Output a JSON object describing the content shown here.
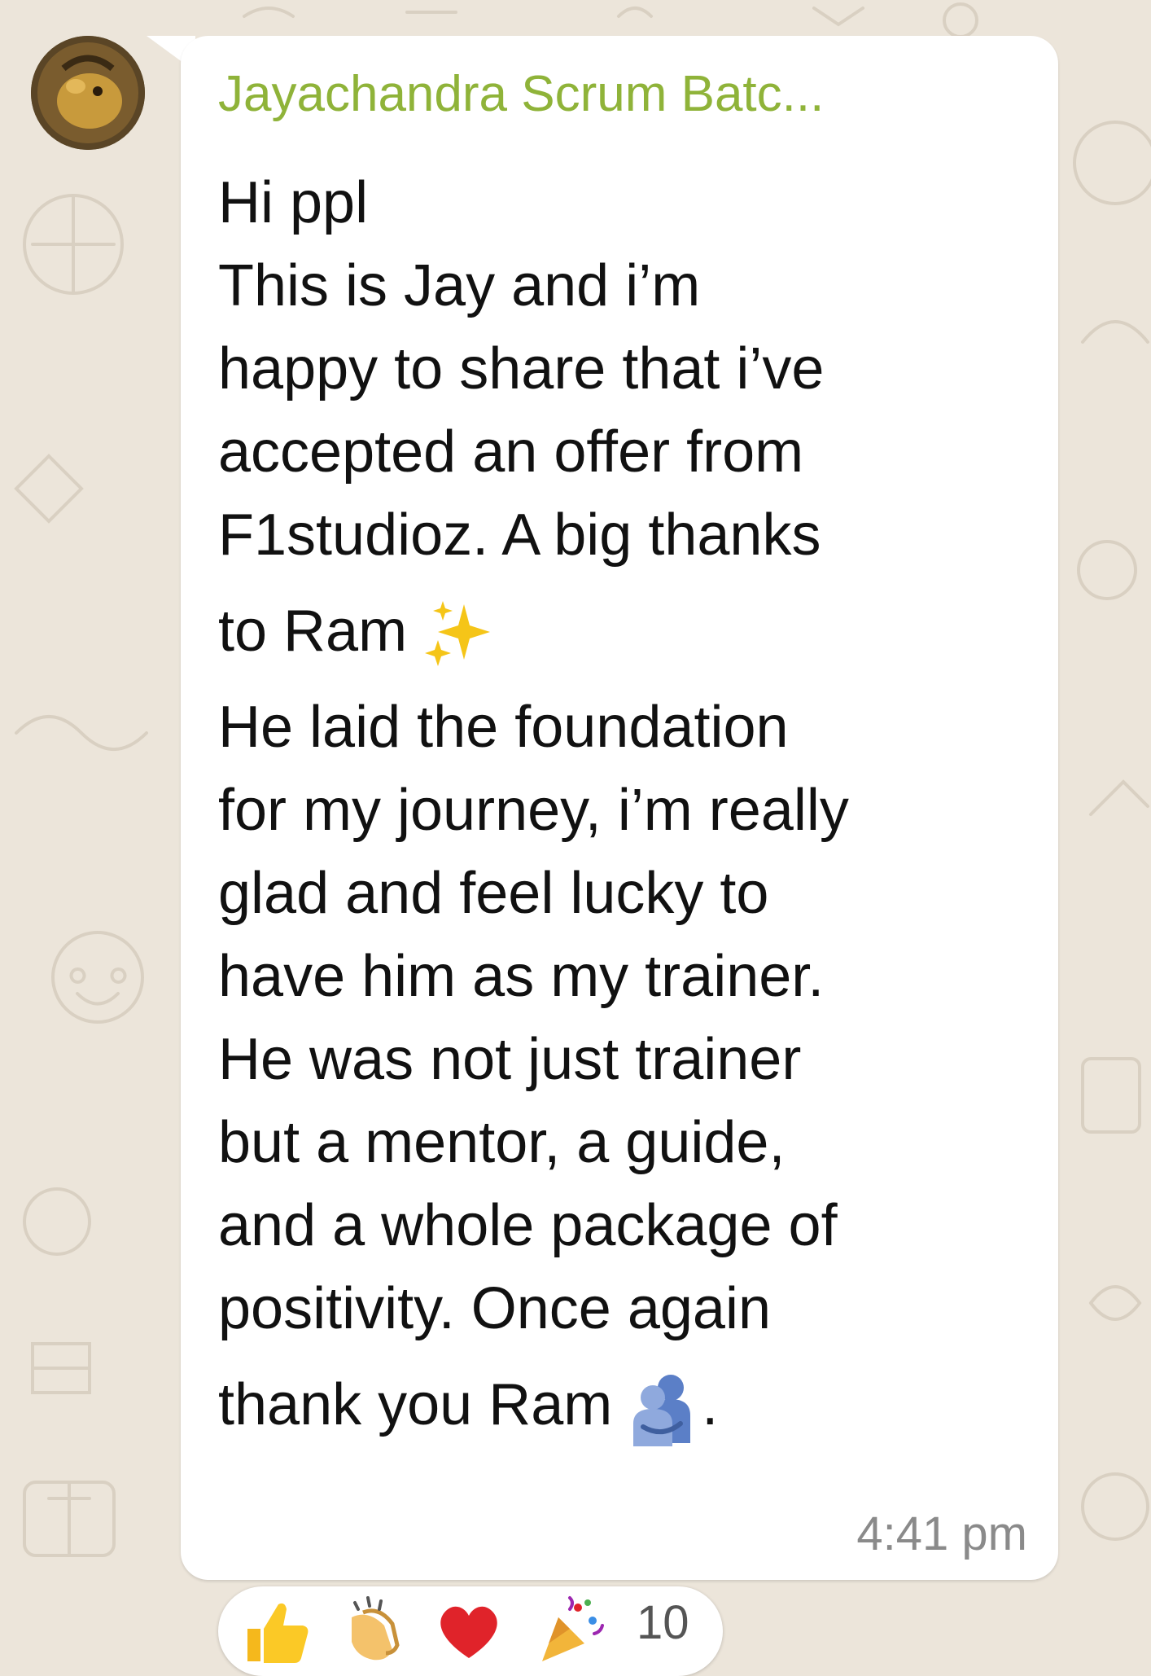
{
  "chat": {
    "sender_name": "Jayachandra Scrum Batc...",
    "sender_color": "#8fb339",
    "message_lines": [
      "Hi ppl",
      "This is Jay and i’m",
      "happy to share that i’ve",
      "accepted an offer from",
      "F1studioz. A big thanks",
      "to Ram",
      "He laid the foundation",
      "for my journey, i’m really",
      "glad and feel lucky to",
      "have him as my trainer.",
      "He was not just trainer",
      "but a mentor, a guide,",
      "and a whole package of",
      "positivity. Once again",
      "thank you Ram",
      "."
    ],
    "timestamp": "4:41 pm",
    "inline_emojis": [
      "sparkles-emoji",
      "hugging-people-emoji"
    ],
    "reactions": {
      "emojis": [
        "thumbs-up-emoji",
        "clapping-hands-emoji",
        "red-heart-emoji",
        "party-popper-emoji"
      ],
      "count": "10"
    }
  }
}
